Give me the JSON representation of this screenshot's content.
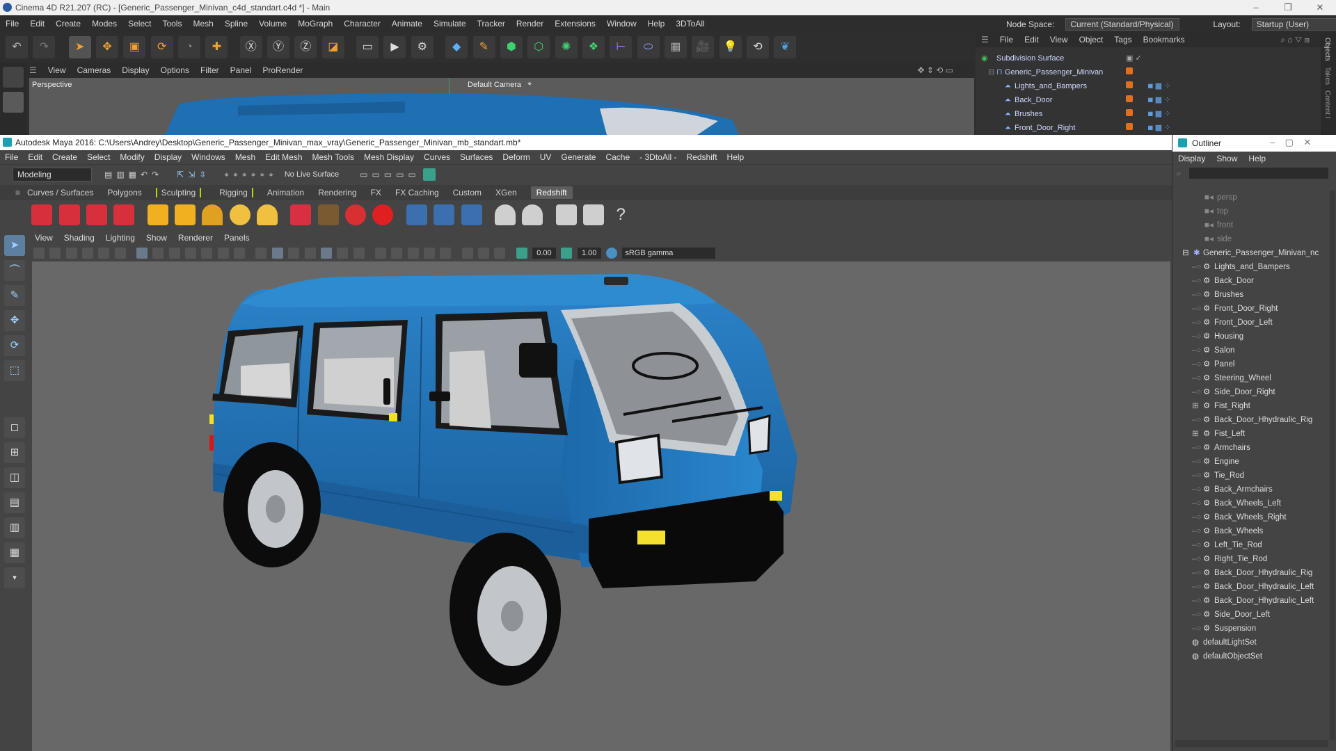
{
  "c4d": {
    "title": "Cinema 4D R21.207 (RC) - [Generic_Passenger_Minivan_c4d_standart.c4d *] - Main",
    "menu": [
      "File",
      "Edit",
      "Create",
      "Modes",
      "Select",
      "Tools",
      "Mesh",
      "Spline",
      "Volume",
      "MoGraph",
      "Character",
      "Animate",
      "Simulate",
      "Tracker",
      "Render",
      "Extensions",
      "Window",
      "Help",
      "3DToAll"
    ],
    "node_space_label": "Node Space:",
    "node_space_value": "Current (Standard/Physical)",
    "layout_label": "Layout:",
    "layout_value": "Startup (User)",
    "viewport_menu": [
      "View",
      "Cameras",
      "Display",
      "Options",
      "Filter",
      "Panel",
      "ProRender"
    ],
    "viewport_name": "Perspective",
    "camera_label": "Default Camera",
    "objects_menu": [
      "File",
      "Edit",
      "View",
      "Object",
      "Tags",
      "Bookmarks"
    ],
    "objects": [
      "Subdivision Surface",
      "Generic_Passenger_Minivan",
      "Lights_and_Bampers",
      "Back_Door",
      "Brushes",
      "Front_Door_Right"
    ],
    "side_tabs": [
      "Objects",
      "Takes",
      "Content Browser"
    ]
  },
  "maya": {
    "title": "Autodesk Maya 2016: C:\\Users\\Andrey\\Desktop\\Generic_Passenger_Minivan_max_vray\\Generic_Passenger_Minivan_mb_standart.mb*",
    "menu": [
      "File",
      "Edit",
      "Create",
      "Select",
      "Modify",
      "Display",
      "Windows",
      "Mesh",
      "Edit Mesh",
      "Mesh Tools",
      "Mesh Display",
      "Curves",
      "Surfaces",
      "Deform",
      "UV",
      "Generate",
      "Cache",
      "- 3DtoAll -",
      "Redshift",
      "Help"
    ],
    "mode": "Modeling",
    "live_surface": "No Live Surface",
    "shelf_tabs": [
      "Curves / Surfaces",
      "Polygons",
      "Sculpting",
      "Rigging",
      "Animation",
      "Rendering",
      "FX",
      "FX Caching",
      "Custom",
      "XGen",
      "Redshift"
    ],
    "active_shelf": "Redshift",
    "viewport_menu": [
      "View",
      "Shading",
      "Lighting",
      "Show",
      "Renderer",
      "Panels"
    ],
    "exposure": "0.00",
    "gamma": "1.00",
    "color_space": "sRGB gamma"
  },
  "outliner": {
    "title": "Outliner",
    "menu": [
      "Display",
      "Show",
      "Help"
    ],
    "cameras": [
      "persp",
      "top",
      "front",
      "side"
    ],
    "root": "Generic_Passenger_Minivan_nc",
    "children": [
      "Lights_and_Bampers",
      "Back_Door",
      "Brushes",
      "Front_Door_Right",
      "Front_Door_Left",
      "Housing",
      "Salon",
      "Panel",
      "Steering_Wheel",
      "Side_Door_Right",
      "Fist_Right",
      "Back_Door_Hhydraulic_Rig",
      "Fist_Left",
      "Armchairs",
      "Engine",
      "Tie_Rod",
      "Back_Armchairs",
      "Back_Wheels_Left",
      "Back_Wheels_Right",
      "Back_Wheels",
      "Left_Tie_Rod",
      "Right_Tie_Rod",
      "Back_Door_Hhydraulic_Rig",
      "Back_Door_Hhydraulic_Left",
      "Back_Door_Hhydraulic_Left",
      "Side_Door_Left",
      "Suspension"
    ],
    "sets": [
      "defaultLightSet",
      "defaultObjectSet"
    ]
  },
  "colors": {
    "van_body": "#1f6fb4",
    "c4d_bg": "#2e2e2e",
    "maya_bg": "#444444",
    "viewport_bg": "#686868"
  }
}
